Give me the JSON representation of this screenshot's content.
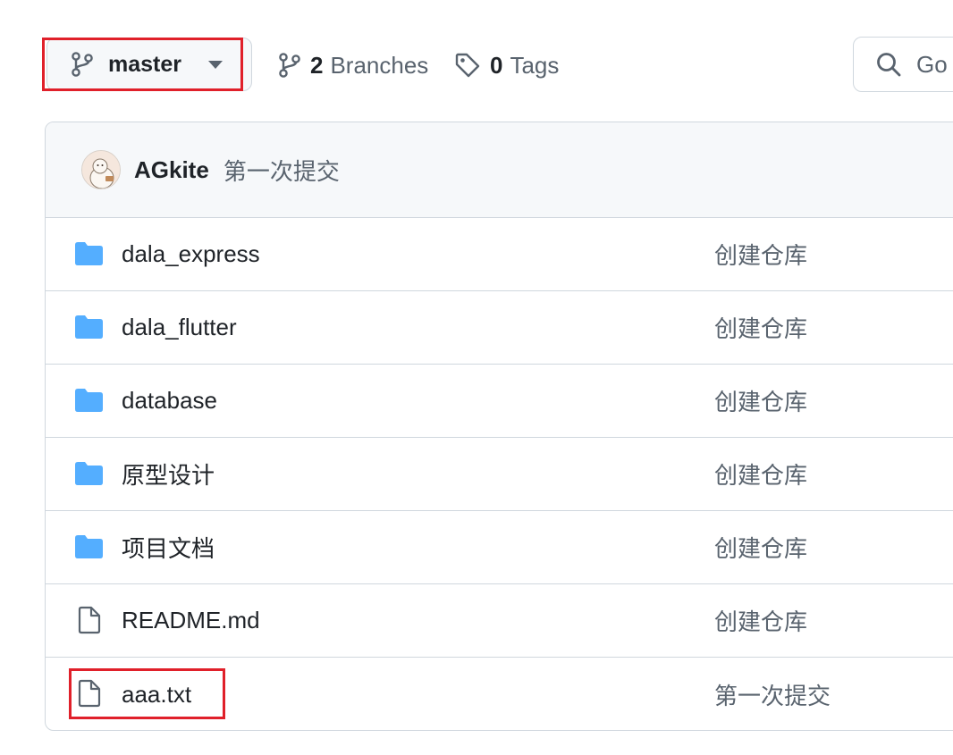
{
  "branch": {
    "name": "master"
  },
  "repo_meta": {
    "branches_count": "2",
    "branches_label": "Branches",
    "tags_count": "0",
    "tags_label": "Tags"
  },
  "search": {
    "placeholder": "Go"
  },
  "latest_commit": {
    "author": "AGkite",
    "message": "第一次提交"
  },
  "files": [
    {
      "type": "folder",
      "icon": "folder-icon",
      "name": "dala_express",
      "commit_message": "创建仓库"
    },
    {
      "type": "folder",
      "icon": "folder-icon",
      "name": "dala_flutter",
      "commit_message": "创建仓库"
    },
    {
      "type": "folder",
      "icon": "folder-icon",
      "name": "database",
      "commit_message": "创建仓库"
    },
    {
      "type": "folder",
      "icon": "folder-icon",
      "name": "原型设计",
      "commit_message": "创建仓库"
    },
    {
      "type": "folder",
      "icon": "folder-icon",
      "name": "项目文档",
      "commit_message": "创建仓库"
    },
    {
      "type": "file",
      "icon": "file-icon",
      "name": "README.md",
      "commit_message": "创建仓库"
    },
    {
      "type": "file",
      "icon": "file-icon",
      "name": "aaa.txt",
      "commit_message": "第一次提交"
    }
  ],
  "colors": {
    "folder": "#54aeff",
    "highlight": "#e0202a",
    "muted_text": "#59636e",
    "border": "#d0d7de"
  }
}
